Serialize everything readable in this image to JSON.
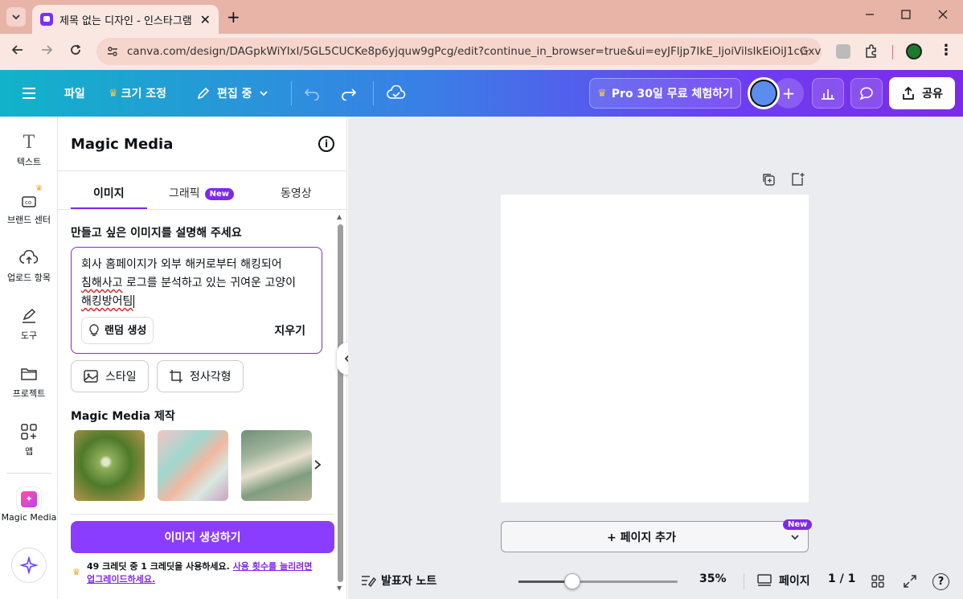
{
  "browser": {
    "tab_title": "제목 없는 디자인 - 인스타그램",
    "tab_close": "✕",
    "new_tab": "+",
    "url": "canva.com/design/DAGpkWiYIxI/5GL5CUCKe8p6yjquw9gPcg/edit?continue_in_browser=true&ui=eyJFljp7IkE_ljoiVilsIkEiOiJ1cGxv..."
  },
  "toolbar": {
    "file": "파일",
    "resize": "크기 조정",
    "editing": "편집 중",
    "pro_trial": "Pro 30일 무료 체험하기",
    "share": "공유"
  },
  "rail": {
    "text": "텍스트",
    "brand": "브랜드 센터",
    "uploads": "업로드 항목",
    "tools": "도구",
    "projects": "프로젝트",
    "apps": "앱",
    "magic_media": "Magic Media"
  },
  "panel": {
    "title": "Magic Media",
    "tabs": {
      "image": "이미지",
      "graphic": "그래픽",
      "graphic_badge": "New",
      "video": "동영상"
    },
    "prompt_label": "만들고 싶은 이미지를 설명해 주세요",
    "prompt_line1": "회사 홈페이지가 외부 해커로부터 해킹되어",
    "prompt_line2_a": "침해사고",
    "prompt_line2_b": " 로그를 분석하고 있는 귀여운 고양이",
    "prompt_line3": "해킹방어팀",
    "random": "랜덤 생성",
    "clear": "지우기",
    "style": "스타일",
    "aspect": "정사각형",
    "made_label": "Magic Media 제작",
    "generate": "이미지 생성하기",
    "credit_text": "49 크레딧 중 1 크레딧을 사용하세요. ",
    "credit_link1": "사용 횟수를 늘리려면",
    "credit_link2": "업그레이드하세요."
  },
  "stage": {
    "add_page": "+ 페이지 추가",
    "new_badge": "New"
  },
  "footer": {
    "notes": "발표자 노트",
    "zoom": "35%",
    "zoom_fraction": 0.35,
    "pages": "페이지",
    "page_count": "1 / 1",
    "help": "?"
  },
  "colors": {
    "accent": "#7d2ae8",
    "generate": "#8b3dff",
    "stage_bg": "#ebecf0"
  }
}
